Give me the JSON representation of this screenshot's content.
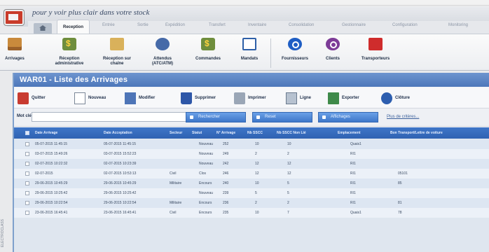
{
  "app": {
    "title": "pour y voir plus clair dans votre stock",
    "sidebar_caption": "ELECTROCLASS"
  },
  "ribbon_tabs": [
    {
      "label": "Reception",
      "active": true
    },
    {
      "label": "Entrée",
      "active": false
    },
    {
      "label": "Sortie",
      "active": false
    },
    {
      "label": "Expédition",
      "active": false
    },
    {
      "label": "Transfert",
      "active": false
    },
    {
      "label": "Inventaire",
      "active": false
    },
    {
      "label": "Consolidation",
      "active": false
    },
    {
      "label": "Gestionnaire",
      "active": false
    },
    {
      "label": "Configuration",
      "active": false
    },
    {
      "label": "Monitoring",
      "active": false
    }
  ],
  "ribbon_buttons": [
    {
      "label": "Arrivages",
      "icon": "box-icon"
    },
    {
      "label": "Réception administrative",
      "icon": "money-box-icon"
    },
    {
      "label": "Réception sur chaîne",
      "icon": "truck-box-icon"
    },
    {
      "label": "Attendus (ATC/ATM)",
      "icon": "settings-icon"
    },
    {
      "label": "Commandes",
      "icon": "order-icon"
    },
    {
      "label": "Mandats",
      "icon": "document-icon"
    },
    {
      "label": "Fournisseurs",
      "icon": "supplier-icon"
    },
    {
      "label": "Clients",
      "icon": "client-icon"
    },
    {
      "label": "Transporteurs",
      "icon": "truck-icon"
    }
  ],
  "window": {
    "title": "WAR01 - Liste des Arrivages"
  },
  "toolbar": {
    "quit": "Quitter",
    "new": "Nouveau",
    "edit": "Modifier",
    "delete": "Supprimer",
    "print": "Imprimer",
    "line": "Ligne",
    "export": "Exporter",
    "close": "Clôture"
  },
  "search": {
    "label": "Mot clé",
    "placeholder": "",
    "search_button": "Rechercher",
    "reset_button": "Reset",
    "other_pages_button": "Affichages",
    "more_criteria": "Plus de critères..."
  },
  "table": {
    "columns": [
      "Date Arrivage",
      "Date Acceptation",
      "Secteur",
      "Statut",
      "N° Arrivage",
      "Nb SSCC",
      "Nb SSCC Non Lié",
      "Emplacement",
      "Bon Transport/Lettre de voiture"
    ],
    "rows": [
      [
        "05-07-2015 11:45:15",
        "05-07-2015 11:45:15",
        "",
        "Nouveau",
        "252",
        "10",
        "10",
        "Quais1",
        ""
      ],
      [
        "03-07-2015 15:49:26",
        "03-07-2015 15:52:23",
        "",
        "Nouveau",
        "249",
        "2",
        "2",
        "RI1",
        ""
      ],
      [
        "02-07-2015 10:22:32",
        "02-07-2015 10:23:39",
        "",
        "Nouveau",
        "242",
        "12",
        "12",
        "RI1",
        ""
      ],
      [
        "02-07-2015",
        "02-07-2015 10:53:13",
        "Civil",
        "Clos",
        "246",
        "12",
        "12",
        "RI1",
        "05101"
      ],
      [
        "29-06-2015 10:45:29",
        "29-06-2015 10:45:29",
        "Militaire",
        "Encours",
        "240",
        "10",
        "5",
        "RI1",
        "85"
      ],
      [
        "29-06-2015 10:25:42",
        "29-06-2015 10:25:42",
        "",
        "Nouveau",
        "239",
        "5",
        "5",
        "RI1",
        ""
      ],
      [
        "29-06-2015 10:22:54",
        "29-06-2015 10:22:54",
        "Militaire",
        "Encours",
        "236",
        "2",
        "2",
        "RI1",
        "81"
      ],
      [
        "23-06-2015 16:45:41",
        "23-06-2015 16:45:41",
        "Civil",
        "Encours",
        "235",
        "10",
        "7",
        "Quais1",
        "78"
      ]
    ]
  }
}
